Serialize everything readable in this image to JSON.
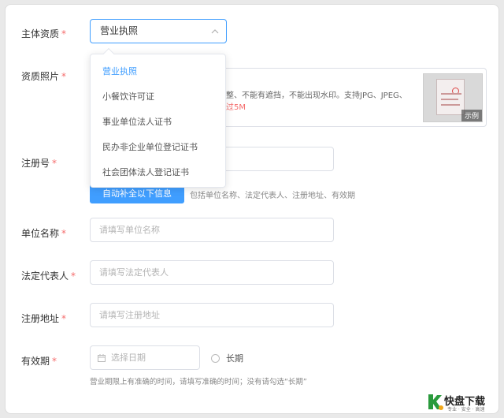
{
  "form": {
    "subject_type": {
      "label": "主体资质",
      "required_mark": "*",
      "selected": "营业执照"
    },
    "dropdown_options": [
      "营业执照",
      "小餐饮许可证",
      "事业单位法人证书",
      "民办非企业单位登记证书",
      "社会团体法人登记证书"
    ],
    "photo": {
      "label": "资质照片",
      "required_mark": "*",
      "requirement_text": "整、不能有遮挡，不能出现水印。支持JPG、JPEG、",
      "size_limit_text": "过5M",
      "sample_tag": "示例"
    },
    "reg_number": {
      "label": "注册号",
      "required_mark": "*"
    },
    "autofill": {
      "button_label": "自动补全以下信息",
      "hint": "包括单位名称、法定代表人、注册地址、有效期"
    },
    "unit_name": {
      "label": "单位名称",
      "required_mark": "*",
      "placeholder": "请填写单位名称"
    },
    "legal_rep": {
      "label": "法定代表人",
      "required_mark": "*",
      "placeholder": "请填写法定代表人"
    },
    "reg_address": {
      "label": "注册地址",
      "required_mark": "*",
      "placeholder": "请填写注册地址"
    },
    "validity": {
      "label": "有效期",
      "required_mark": "*",
      "date_placeholder": "选择日期",
      "long_term_label": "长期",
      "hint": "营业期限上有准确的时间，请填写准确的时间；没有请勾选“长期”"
    }
  },
  "watermark": {
    "brand": "快盘下载",
    "slogan": "专业 · 安全 · 高速"
  },
  "colors": {
    "primary": "#409eff",
    "required": "#f56c6c",
    "border": "#dcdfe6"
  }
}
